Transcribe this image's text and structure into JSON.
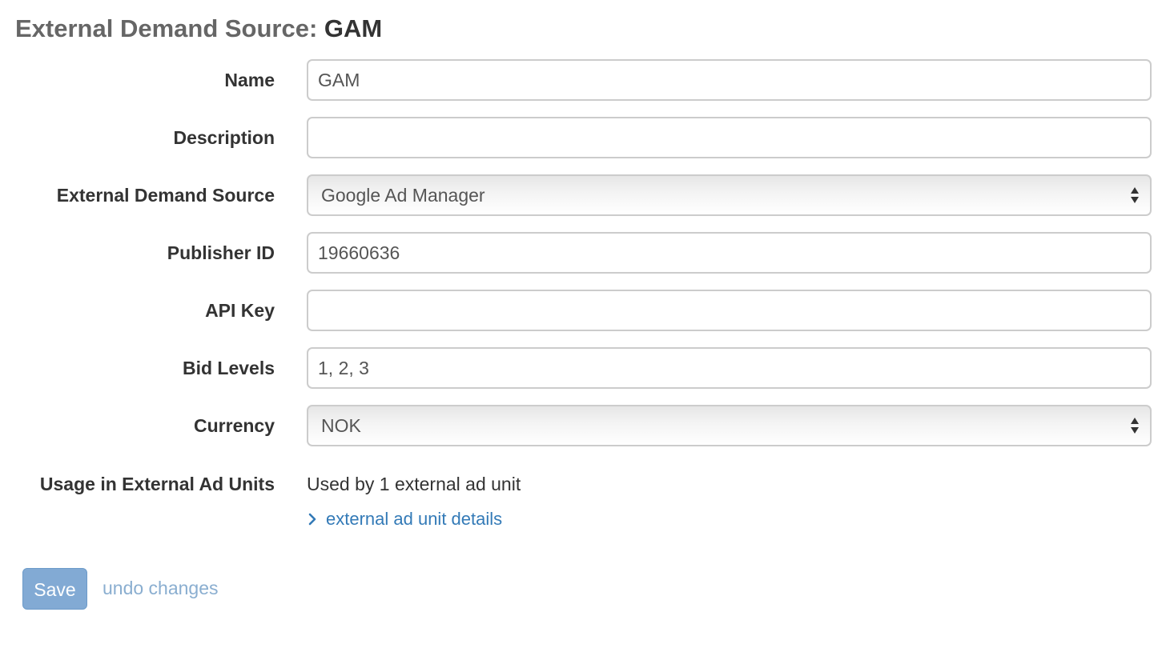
{
  "header": {
    "title_prefix": "External Demand Source:",
    "title_value": "GAM"
  },
  "form": {
    "name": {
      "label": "Name",
      "value": "GAM",
      "placeholder": ""
    },
    "description": {
      "label": "Description",
      "value": "",
      "placeholder": ""
    },
    "external_demand_source": {
      "label": "External Demand Source",
      "selected": "Google Ad Manager"
    },
    "publisher_id": {
      "label": "Publisher ID",
      "value": "19660636",
      "placeholder": ""
    },
    "api_key": {
      "label": "API Key",
      "value": "",
      "placeholder": ""
    },
    "bid_levels": {
      "label": "Bid Levels",
      "value": "1, 2, 3",
      "placeholder": ""
    },
    "currency": {
      "label": "Currency",
      "selected": "NOK"
    },
    "usage": {
      "label": "Usage in External Ad Units",
      "text": "Used by 1 external ad unit",
      "details_link": "external ad unit details"
    }
  },
  "actions": {
    "save_label": "Save",
    "undo_label": "undo changes"
  },
  "icons": {
    "select_arrows": "select-arrows-icon",
    "details_chevron": "chevron-right-icon"
  },
  "colors": {
    "link": "#337ab7",
    "save_button": "#82aad4",
    "undo_link": "#8aaed0"
  }
}
